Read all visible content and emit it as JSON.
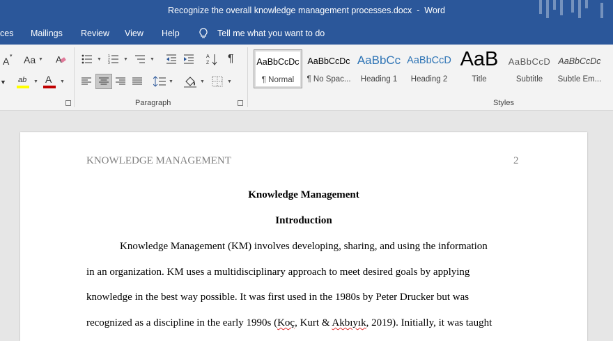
{
  "window": {
    "title": "Recognize the overall knowledge management processes.docx  -  Word"
  },
  "tabs": {
    "references_partial": "ces",
    "mailings": "Mailings",
    "review": "Review",
    "view": "View",
    "help": "Help",
    "tell_me": "Tell me what you want to do"
  },
  "ribbon": {
    "font_size_shrink": "A",
    "change_case": "Aa",
    "highlight_glyph": "ab",
    "font_color_glyph": "A",
    "paragraph_mark": "¶",
    "paragraph_label": "Paragraph",
    "styles_label": "Styles",
    "font_color_hex": "#c00000",
    "highlight_hex": "#ffff00"
  },
  "styles": [
    {
      "sample": "AaBbCcDc",
      "name": "¶ Normal",
      "selected": true
    },
    {
      "sample": "AaBbCcDc",
      "name": "¶ No Spac...",
      "selected": false
    },
    {
      "sample": "AaBbCc",
      "name": "Heading 1",
      "selected": false
    },
    {
      "sample": "AaBbCcD",
      "name": "Heading 2",
      "selected": false
    },
    {
      "sample": "AaB",
      "name": "Title",
      "selected": false
    },
    {
      "sample": "AaBbCcD",
      "name": "Subtitle",
      "selected": false
    },
    {
      "sample": "AaBbCcDc",
      "name": "Subtle Em...",
      "selected": false
    }
  ],
  "document": {
    "running_head": "KNOWLEDGE MANAGEMENT",
    "page_number": "2",
    "title": "Knowledge Management",
    "section_heading": "Introduction",
    "lines": [
      "Knowledge Management (KM) involves developing, sharing, and using the information",
      "in an organization. KM uses a multidisciplinary approach to meet desired goals by applying",
      "knowledge in the best way possible. It was first used in the 1980s by Peter Drucker but was"
    ],
    "line4": {
      "before": "recognized as a discipline in the early 1990s (",
      "word1": "Koç",
      "mid": ", Kurt & ",
      "word2": "Akbıyık",
      "after": ", 2019). Initially, it was taught"
    }
  }
}
